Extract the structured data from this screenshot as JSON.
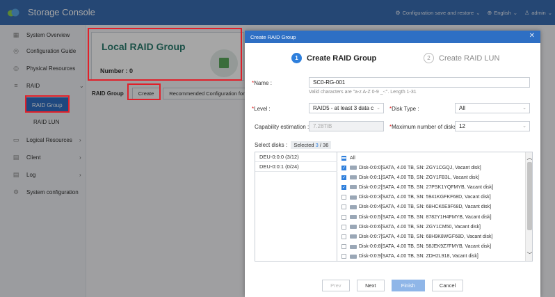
{
  "app": {
    "title": "Storage Console"
  },
  "topbar": {
    "config": "Configuration save and restore",
    "language": "English",
    "user": "admin"
  },
  "sidebar": {
    "items": [
      {
        "label": "System Overview",
        "icon": "overview-icon"
      },
      {
        "label": "Configuration Guide",
        "icon": "guide-icon"
      },
      {
        "label": "Physical Resources",
        "icon": "physical-icon"
      },
      {
        "label": "RAID",
        "icon": "raid-icon"
      },
      {
        "label": "Logical Resources",
        "icon": "logical-icon"
      },
      {
        "label": "Client",
        "icon": "client-icon"
      },
      {
        "label": "Log",
        "icon": "log-icon"
      },
      {
        "label": "System configuration",
        "icon": "settings-icon"
      }
    ],
    "raid_sub": [
      "RAID Group",
      "RAID LUN"
    ]
  },
  "main": {
    "card_title": "Local RAID Group",
    "card_number": "Number : 0",
    "toolbar_label": "RAID Group",
    "create": "Create",
    "recommended": "Recommended Configuration for"
  },
  "dialog": {
    "title": "Create RAID Group",
    "steps": [
      {
        "num": "1",
        "label": "Create RAID Group"
      },
      {
        "num": "2",
        "label": "Create RAID LUN"
      }
    ],
    "name_label": "Name :",
    "name_value": "SC0-RG-001",
    "name_hint": "Valid characters are \"a-z A-Z 0-9 _-:\". Length 1-31",
    "level_label": "Level :",
    "level_value": "RAID5 - at least 3 data c",
    "disk_type_label": "Disk Type :",
    "disk_type_value": "All",
    "capability_label": "Capability estimation :",
    "capability_value": "7.28TiB",
    "max_disks_label": "Maximum number of disks :",
    "max_disks_value": "12",
    "select_label": "Select disks :",
    "selected_word": "Selected",
    "selected_count": "3",
    "selected_total": "/ 36",
    "groups": [
      "DEU-0:0:0 (3/12)",
      "DEU-0:0:1 (0/24)"
    ],
    "all_label": "All",
    "disks": [
      {
        "label": "Disk-0:0:0[SATA, 4.00 TB, SN: ZGY1CGQJ, Vacant disk]",
        "checked": true
      },
      {
        "label": "Disk-0:0:1[SATA, 4.00 TB, SN: ZGY1FB3L, Vacant disk]",
        "checked": true
      },
      {
        "label": "Disk-0:0:2[SATA, 4.00 TB, SN: 27PSK1YQFMYB, Vacant disk]",
        "checked": true
      },
      {
        "label": "Disk-0:0:3[SATA, 4.00 TB, SN: 5941KGFKF68D, Vacant disk]",
        "checked": false
      },
      {
        "label": "Disk-0:0:4[SATA, 4.00 TB, SN: 68HCK6E9F68D, Vacant disk]",
        "checked": false
      },
      {
        "label": "Disk-0:0:5[SATA, 4.00 TB, SN: 8782Y1H4FMYB, Vacant disk]",
        "checked": false
      },
      {
        "label": "Disk-0:0:6[SATA, 4.00 TB, SN: ZGY1CM50, Vacant disk]",
        "checked": false
      },
      {
        "label": "Disk-0:0:7[SATA, 4.00 TB, SN: 68H9K8WGF68D, Vacant disk]",
        "checked": false
      },
      {
        "label": "Disk-0:0:8[SATA, 4.00 TB, SN: 58JEK9Z7FMYB, Vacant disk]",
        "checked": false
      },
      {
        "label": "Disk-0:0:9[SATA, 4.00 TB, SN: ZDH2L918, Vacant disk]",
        "checked": false
      }
    ],
    "buttons": {
      "prev": "Prev",
      "next": "Next",
      "finish": "Finish",
      "cancel": "Cancel"
    }
  },
  "colors": {
    "header": "#3a6db2",
    "accent": "#2e6fc4",
    "highlight": "#e0202a",
    "card_title": "#2b7d6f"
  }
}
